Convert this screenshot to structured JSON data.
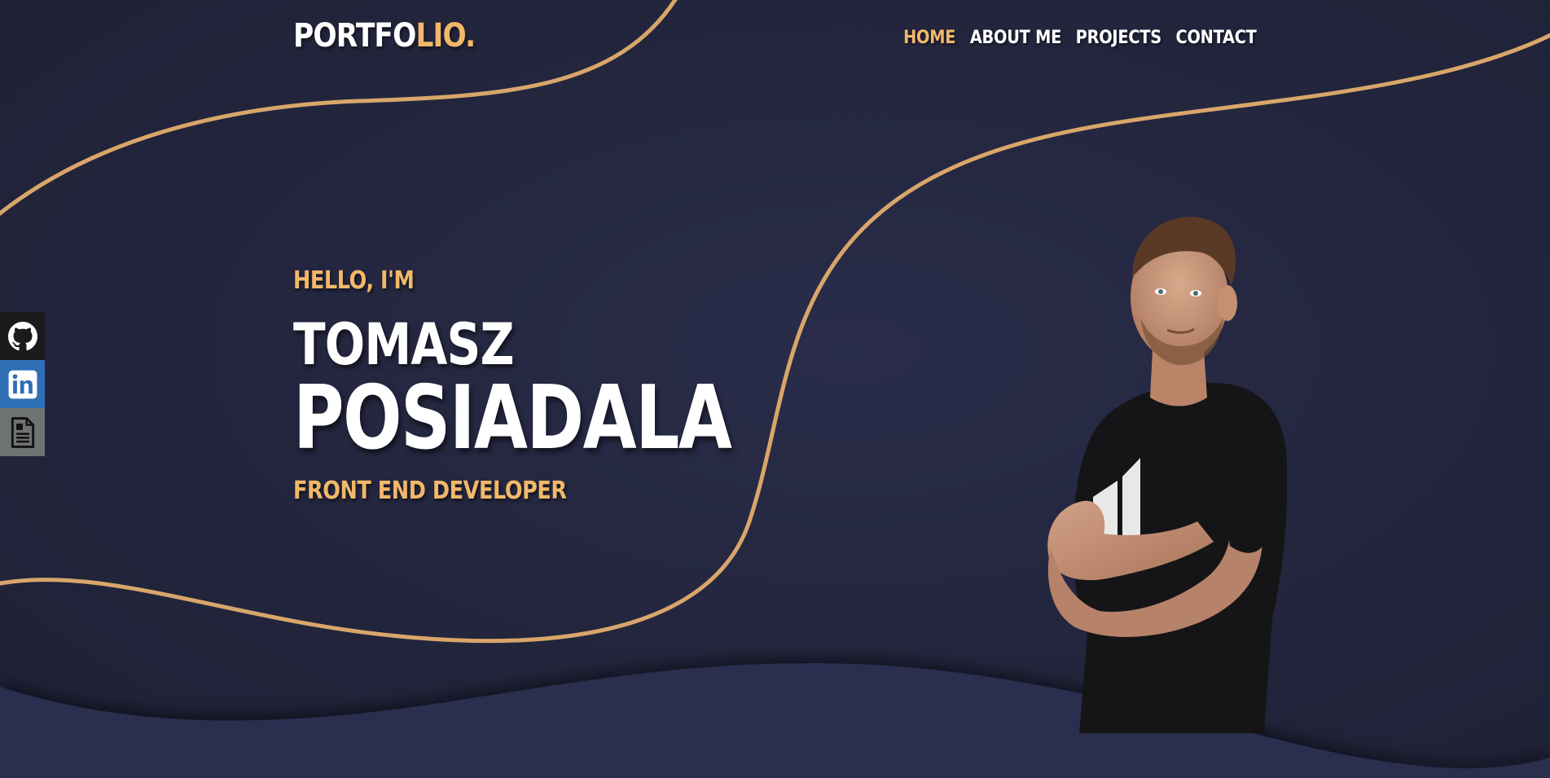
{
  "logo": {
    "part1": "PORTFO",
    "part2": "LIO."
  },
  "nav": {
    "items": [
      {
        "label": "HOME",
        "active": true
      },
      {
        "label": "ABOUT ME",
        "active": false
      },
      {
        "label": "PROJECTS",
        "active": false
      },
      {
        "label": "CONTACT",
        "active": false
      }
    ]
  },
  "social": {
    "items": [
      {
        "icon": "github-icon",
        "color": "#1b1b1e"
      },
      {
        "icon": "linkedin-icon",
        "color": "#2f6fb6"
      },
      {
        "icon": "resume-document-icon",
        "color": "#6e7270"
      }
    ]
  },
  "hero": {
    "greeting": "HELLO, I'M",
    "first_name": "TOMASZ",
    "last_name": "POSIADALA",
    "role": "FRONT END DEVELOPER"
  },
  "colors": {
    "background": "#23253d",
    "accent": "#f2b869",
    "wave": "#2a2d4f",
    "text": "#ffffff"
  }
}
